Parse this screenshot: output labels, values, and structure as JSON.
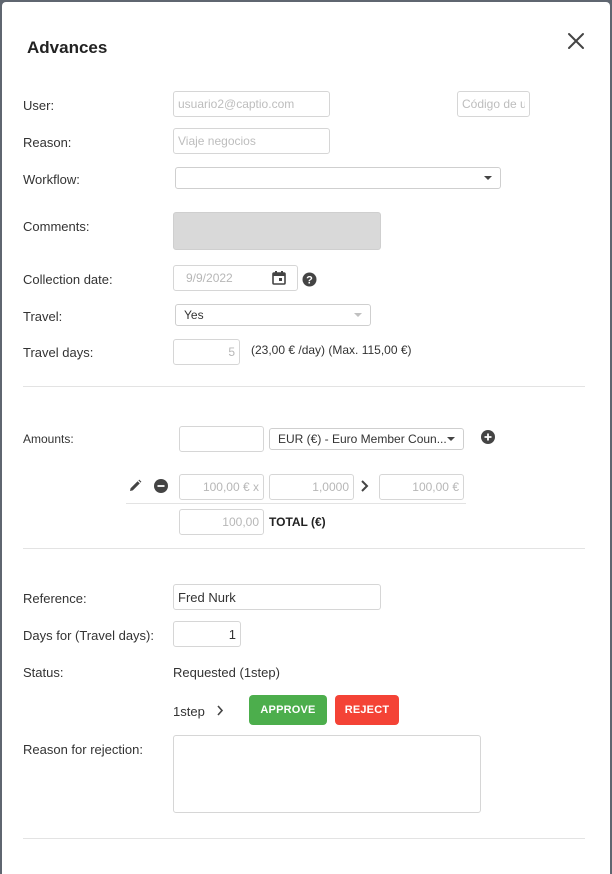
{
  "modal": {
    "title": "Advances"
  },
  "user": {
    "label": "User:",
    "placeholder": "usuario2@captio.com",
    "code_placeholder": "Código de u"
  },
  "reason": {
    "label": "Reason:",
    "placeholder": "Viaje negocios"
  },
  "workflow": {
    "label": "Workflow:",
    "value": ""
  },
  "comments": {
    "label": "Comments:",
    "value": ""
  },
  "collection_date": {
    "label": "Collection date:",
    "value": "9/9/2022"
  },
  "travel": {
    "label": "Travel:",
    "value": "Yes"
  },
  "travel_days": {
    "label": "Travel days:",
    "value": "5",
    "info": "(23,00 € /day) (Max. 115,00 €)"
  },
  "amounts": {
    "label": "Amounts:",
    "amount_value": "",
    "currency": "EUR (€) - Euro Member Coun...",
    "row": {
      "amount": "100,00 € x",
      "rate": "1,0000",
      "result": "100,00 €"
    },
    "total_value": "100,00",
    "total_label": "TOTAL (€)"
  },
  "reference": {
    "label": "Reference:",
    "value": "Fred Nurk"
  },
  "days_for": {
    "label": "Days for (Travel days):",
    "value": "1"
  },
  "status": {
    "label": "Status:",
    "value": "Requested (1step)"
  },
  "approval": {
    "step": "1step",
    "approve_label": "APPROVE",
    "reject_label": "REJECT"
  },
  "rejection": {
    "label": "Reason for rejection:",
    "value": ""
  },
  "colors": {
    "approve": "#4cae4c",
    "reject": "#f44336",
    "comments_bg": "#d9d9d9"
  },
  "icons": [
    "close-icon",
    "calendar-icon",
    "help-icon",
    "caret-down-icon",
    "plus-circle-icon",
    "pencil-icon",
    "minus-circle-icon",
    "chevron-right-icon"
  ]
}
